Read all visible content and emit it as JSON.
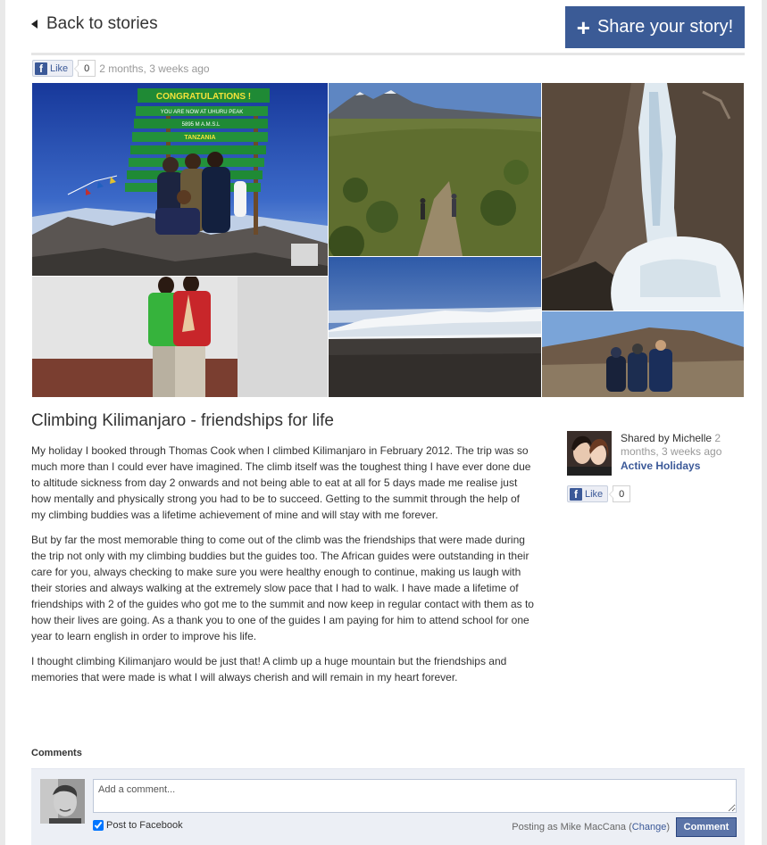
{
  "nav": {
    "back_label": "Back to stories"
  },
  "share": {
    "plus": "+",
    "label": "Share your story!"
  },
  "top_like": {
    "like_label": "Like",
    "count": "0",
    "time_ago": "2 months, 3 weeks ago"
  },
  "story": {
    "title": "Climbing Kilimanjaro - friendships for life",
    "paragraphs": [
      "My holiday I booked through Thomas Cook when I climbed Kilimanjaro in February 2012. The trip was so much more than I could ever have imagined. The climb itself was the toughest thing I have ever done due to altitude sickness from day 2 onwards and not being able to eat at all for 5 days made me realise just how mentally and physically strong you had to be to succeed. Getting to the summit through the help of my climbing buddies was a lifetime achievement of mine and will stay with me forever.",
      "But by far the most memorable thing to come out of the climb was the friendships that were made during the trip not only with my climbing buddies but the guides too. The African guides were outstanding in their care for you, always checking to make sure you were healthy enough to continue, making us laugh with their stories and always walking at the extremely slow pace that I had to walk. I have made a lifetime of friendships with 2 of the guides who got me to the summit and now keep in regular contact with them as to how their lives are going. As a thank you to one of the guides I am paying for him to attend school for one year to learn english in order to improve his life.",
      "I thought climbing Kilimanjaro would be just that! A climb up a huge mountain but the friendships and memories that were made is what I will always cherish and will remain in my heart forever."
    ]
  },
  "sidebar": {
    "shared_prefix": "Shared by Michelle",
    "shared_time": "2 months, 3 weeks ago",
    "category": "Active Holidays",
    "like_label": "Like",
    "like_count": "0"
  },
  "comments": {
    "heading": "Comments",
    "placeholder": "Add a comment...",
    "post_to_facebook": "Post to Facebook",
    "posting_as": "Posting as Mike MacCana",
    "change_label": "Change",
    "submit_label": "Comment"
  },
  "photos": {
    "sign_text": "CONGRATULATIONS !",
    "sign_sub": "YOU ARE NOW AT UHURU PEAK",
    "sign_alt": "5895 M  A.M.S.L",
    "sign_country": "TANZANIA"
  },
  "colors": {
    "brand": "#3b5b96",
    "facebook": "#3b5998",
    "comment_bg": "#eceff5"
  }
}
